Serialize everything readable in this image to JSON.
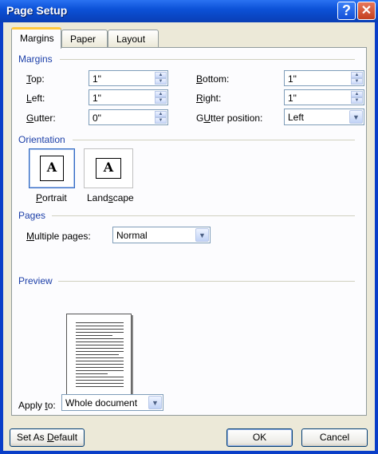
{
  "window": {
    "title": "Page Setup",
    "help_label": "?",
    "close_label": "✕"
  },
  "tabs": [
    {
      "label": "Margins"
    },
    {
      "label": "Paper"
    },
    {
      "label": "Layout"
    }
  ],
  "margins": {
    "heading": "Margins",
    "top": {
      "label_key": "T",
      "label_rest": "op:",
      "value": "1\""
    },
    "left": {
      "label_key": "L",
      "label_rest": "eft:",
      "value": "1\""
    },
    "gutter": {
      "label_key": "G",
      "label_rest": "utter:",
      "value": "0\""
    },
    "bottom": {
      "label_key": "B",
      "label_rest": "ottom:",
      "value": "1\""
    },
    "right": {
      "label_key": "R",
      "label_rest": "ight:",
      "value": "1\""
    },
    "gutter_position": {
      "label_key": "U",
      "label_pre": "G",
      "label_rest": "tter position:",
      "value": "Left"
    }
  },
  "orientation": {
    "heading": "Orientation",
    "portrait": {
      "label_key": "P",
      "label_rest": "ortrait",
      "glyph": "A"
    },
    "landscape": {
      "label_pre": "Land",
      "label_key": "s",
      "label_rest": "cape",
      "glyph": "A"
    }
  },
  "pages": {
    "heading": "Pages",
    "multiple_pages": {
      "label_key": "M",
      "label_rest": "ultiple pages:",
      "value": "Normal"
    }
  },
  "preview": {
    "heading": "Preview",
    "apply_to": {
      "label_pre": "Apply ",
      "label_key": "t",
      "label_rest": "o:",
      "value": "Whole document"
    }
  },
  "buttons": {
    "set_default": {
      "label_pre": "Set As ",
      "label_key": "D",
      "label_rest": "efault"
    },
    "ok": "OK",
    "cancel": "Cancel"
  },
  "icons": {
    "spin_up": "▲",
    "spin_down": "▼",
    "dropdown": "▼"
  }
}
